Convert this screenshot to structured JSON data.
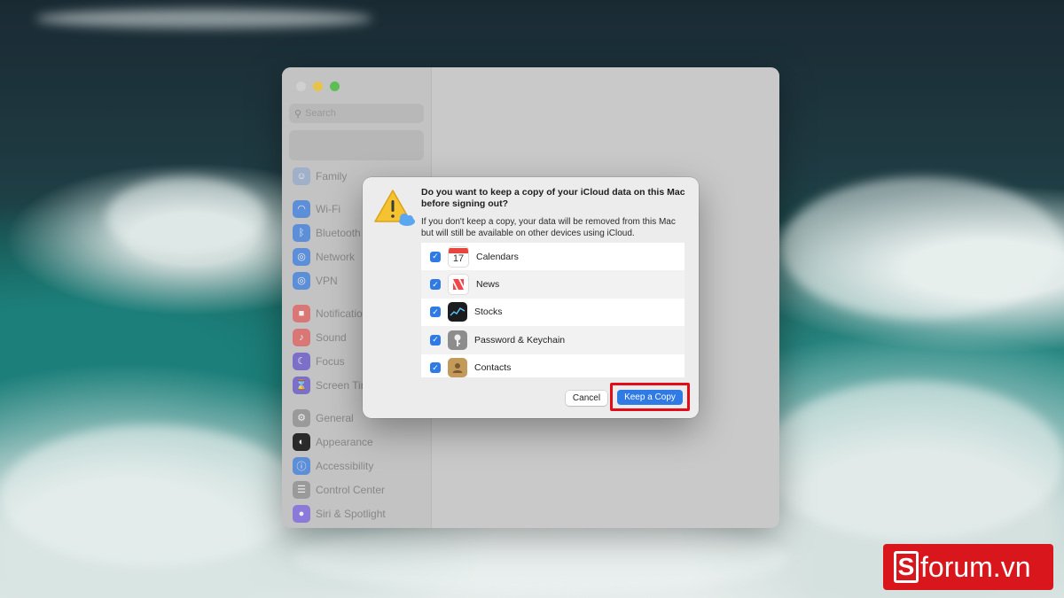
{
  "window": {
    "search_placeholder": "Search",
    "sidebar_items": [
      {
        "label": "Family",
        "icon": "family-icon",
        "color": "#9fb0c8"
      },
      {
        "label": "Wi-Fi",
        "icon": "wifi-icon",
        "color": "#5d8fd8"
      },
      {
        "label": "Bluetooth",
        "icon": "bluetooth-icon",
        "color": "#5d8fd8"
      },
      {
        "label": "Network",
        "icon": "network-icon",
        "color": "#5d8fd8"
      },
      {
        "label": "VPN",
        "icon": "vpn-icon",
        "color": "#5d8fd8"
      },
      {
        "label": "Notifications",
        "icon": "notifications-icon",
        "color": "#d97676"
      },
      {
        "label": "Sound",
        "icon": "sound-icon",
        "color": "#d97676"
      },
      {
        "label": "Focus",
        "icon": "focus-icon",
        "color": "#7b6fc7"
      },
      {
        "label": "Screen Time",
        "icon": "screen-time-icon",
        "color": "#7b6fc7"
      },
      {
        "label": "General",
        "icon": "general-icon",
        "color": "#9a9a9a"
      },
      {
        "label": "Appearance",
        "icon": "appearance-icon",
        "color": "#2a2a2a"
      },
      {
        "label": "Accessibility",
        "icon": "accessibility-icon",
        "color": "#5d8fd8"
      },
      {
        "label": "Control Center",
        "icon": "control-center-icon",
        "color": "#9a9a9a"
      },
      {
        "label": "Siri & Spotlight",
        "icon": "siri-icon",
        "color": "#8c7ad9"
      }
    ]
  },
  "dialog": {
    "title": "Do you want to keep a copy of your iCloud data on this Mac before signing out?",
    "body": "If you don't keep a copy, your data will be removed from this Mac but will still be available on other devices using iCloud.",
    "items": [
      {
        "label": "Calendars",
        "checked": true,
        "icon": "calendar-icon",
        "icon_text": "17"
      },
      {
        "label": "News",
        "checked": true,
        "icon": "news-icon"
      },
      {
        "label": "Stocks",
        "checked": true,
        "icon": "stocks-icon"
      },
      {
        "label": "Password & Keychain",
        "checked": true,
        "icon": "keychain-icon"
      },
      {
        "label": "Contacts",
        "checked": true,
        "icon": "contacts-icon"
      }
    ],
    "cancel_label": "Cancel",
    "keep_label": "Keep a Copy"
  },
  "watermark": {
    "letter": "S",
    "text": "forum.vn"
  },
  "colors": {
    "accent": "#2f7ae5",
    "highlight": "#e30b17",
    "logo": "#d8161c"
  }
}
